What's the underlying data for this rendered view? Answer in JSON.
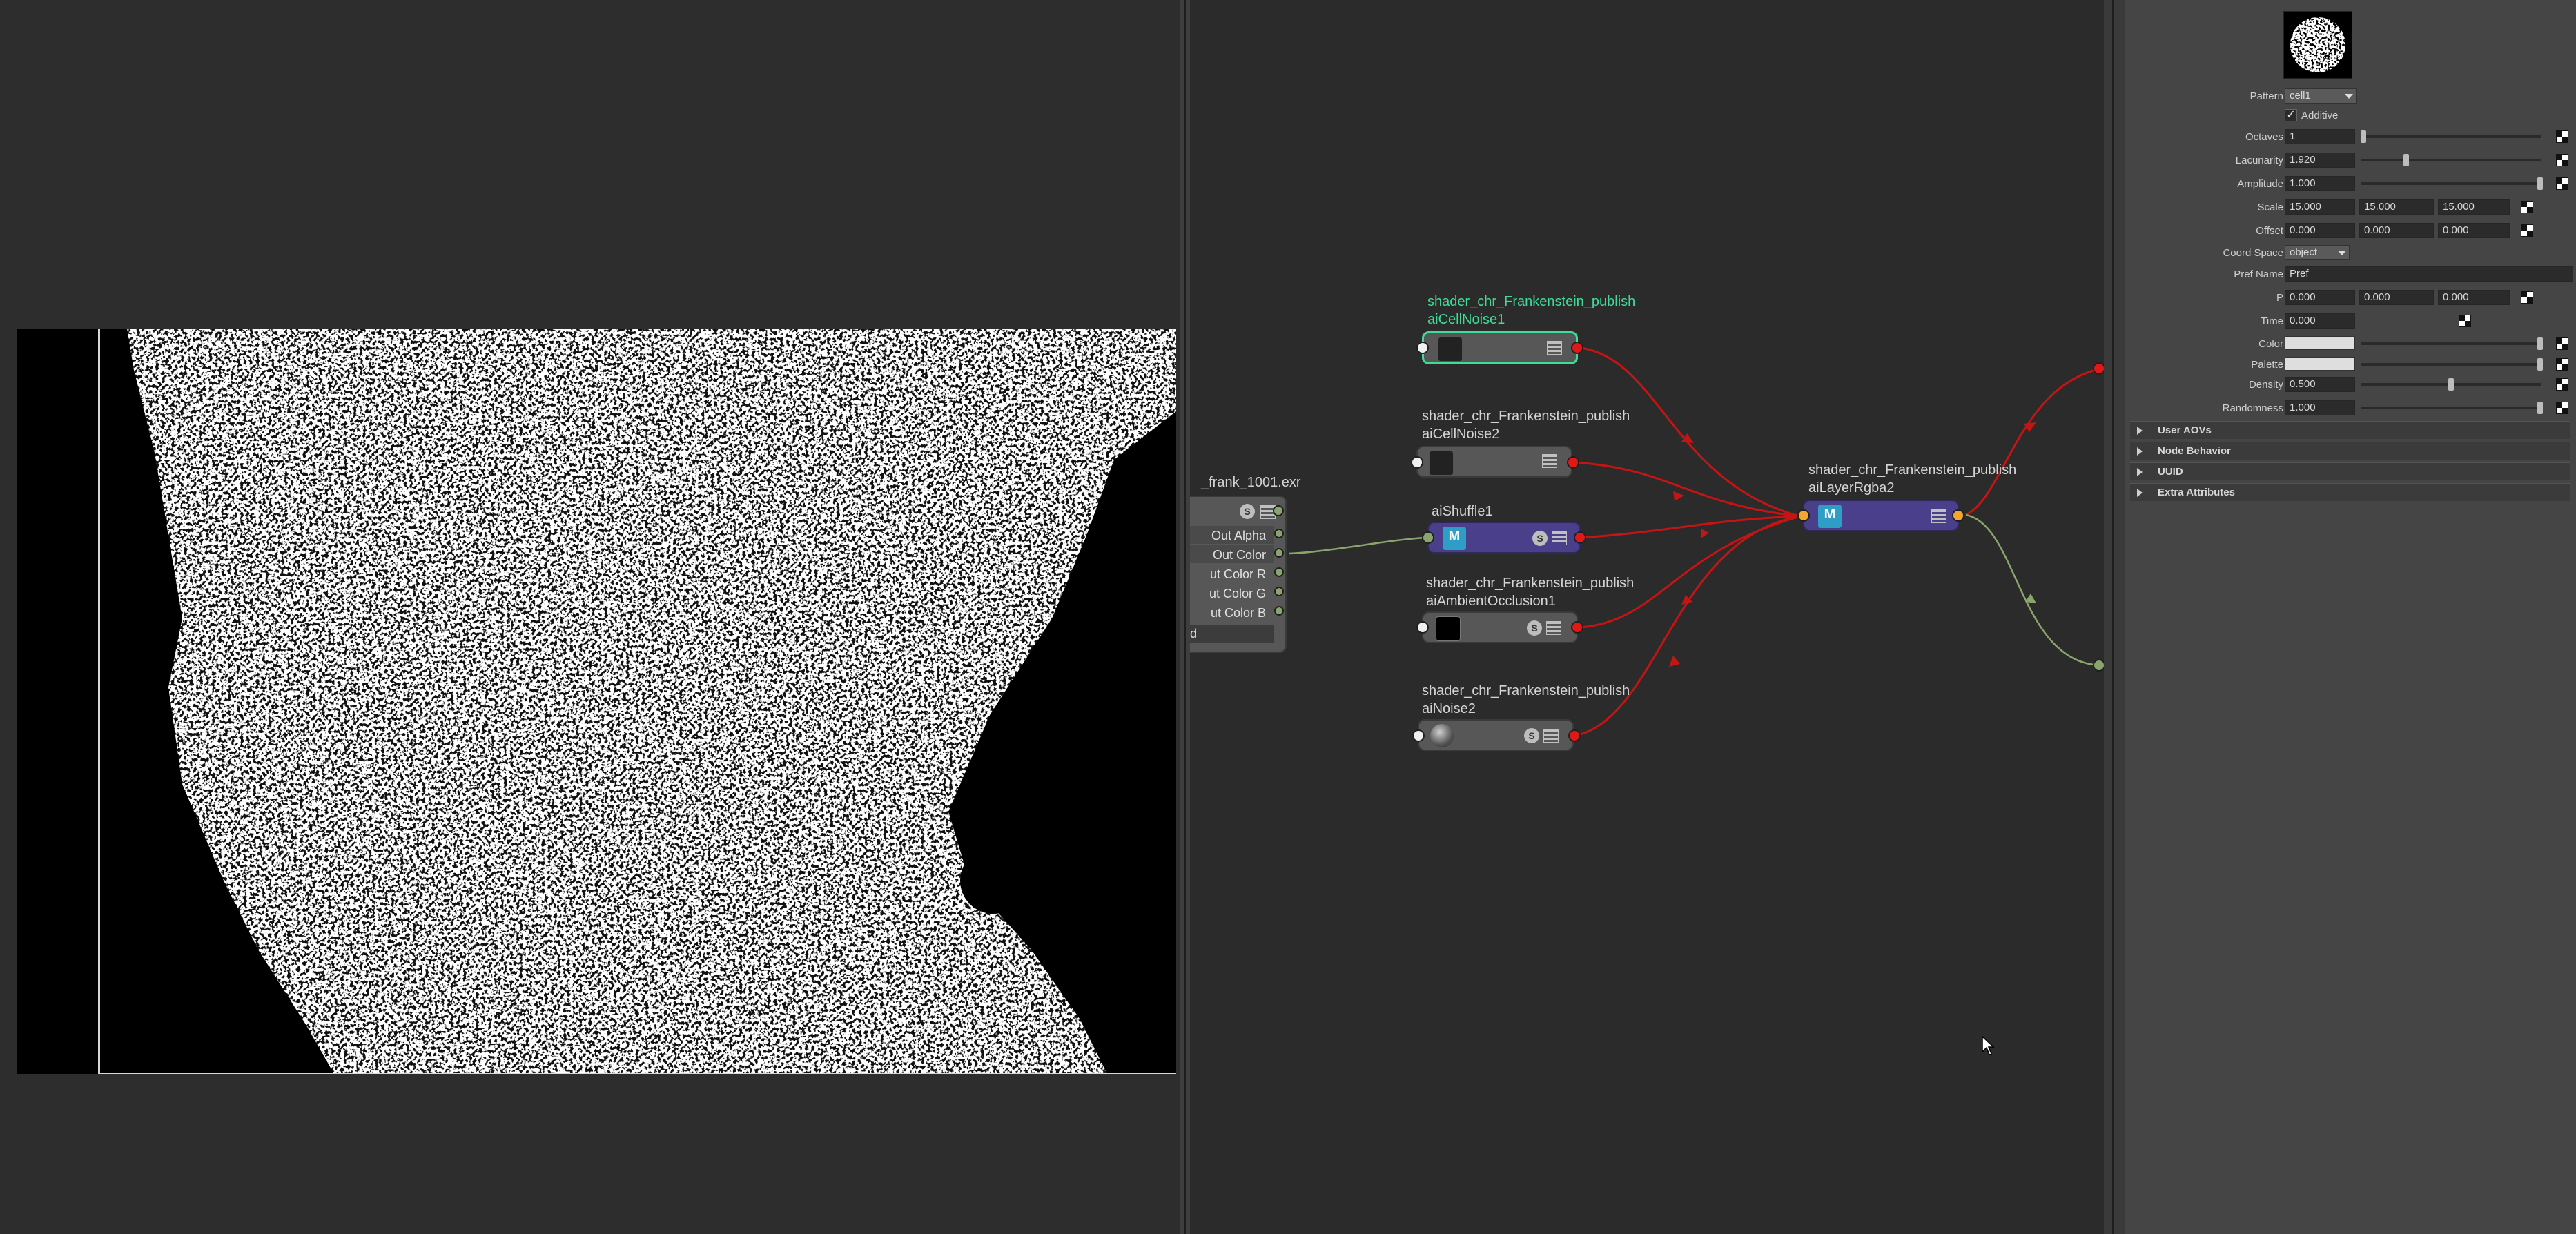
{
  "nodes": {
    "cellnoise1": {
      "title_line1": "shader_chr_Frankenstein_publish",
      "title_line2": "aiCellNoise1"
    },
    "cellnoise2": {
      "title_line1": "shader_chr_Frankenstein_publish",
      "title_line2": "aiCellNoise2"
    },
    "shuffle1": {
      "title": "aiShuffle1",
      "thumb_label": "M"
    },
    "ao1": {
      "title_line1": "shader_chr_Frankenstein_publish",
      "title_line2": "aiAmbientOcclusion1"
    },
    "noise2": {
      "title_line1": "shader_chr_Frankenstein_publish",
      "title_line2": "aiNoise2"
    },
    "layer_rgba2": {
      "title_line1": "shader_chr_Frankenstein_publish",
      "title_line2": "aiLayerRgba2",
      "thumb_label": "M"
    },
    "file": {
      "title": "_frank_1001.exr",
      "attrs": [
        "Out Alpha",
        "Out Color",
        "ut Color R",
        "ut Color G",
        "ut Color B",
        "d"
      ]
    },
    "s_badge": "S"
  },
  "attributes": {
    "pattern": {
      "label": "Pattern",
      "value": "cell1"
    },
    "additive": {
      "label": "Additive",
      "checked": true
    },
    "octaves": {
      "label": "Octaves",
      "value": "1",
      "fraction": 0.0
    },
    "lacunarity": {
      "label": "Lacunarity",
      "value": "1.920",
      "fraction": 0.24
    },
    "amplitude": {
      "label": "Amplitude",
      "value": "1.000",
      "fraction": 1.0
    },
    "scale": {
      "label": "Scale",
      "x": "15.000",
      "y": "15.000",
      "z": "15.000"
    },
    "offset": {
      "label": "Offset",
      "x": "0.000",
      "y": "0.000",
      "z": "0.000"
    },
    "coord_space": {
      "label": "Coord Space",
      "value": "object"
    },
    "pref_name": {
      "label": "Pref Name",
      "value": "Pref"
    },
    "p": {
      "label": "P",
      "x": "0.000",
      "y": "0.000",
      "z": "0.000"
    },
    "time": {
      "label": "Time",
      "value": "0.000"
    },
    "color": {
      "label": "Color",
      "swatch": "#dedede"
    },
    "palette": {
      "label": "Palette",
      "swatch": "#dedede"
    },
    "density": {
      "label": "Density",
      "value": "0.500",
      "fraction": 0.5
    },
    "randomness": {
      "label": "Randomness",
      "value": "1.000",
      "fraction": 1.0
    }
  },
  "sections": [
    "User AOVs",
    "Node Behavior",
    "UUID",
    "Extra Attributes"
  ],
  "colors": {
    "selected_node": "#3ddc97",
    "purple_node": "#4a3f8a",
    "red_connection": "#c41414",
    "green_connection": "#8aa56b"
  }
}
